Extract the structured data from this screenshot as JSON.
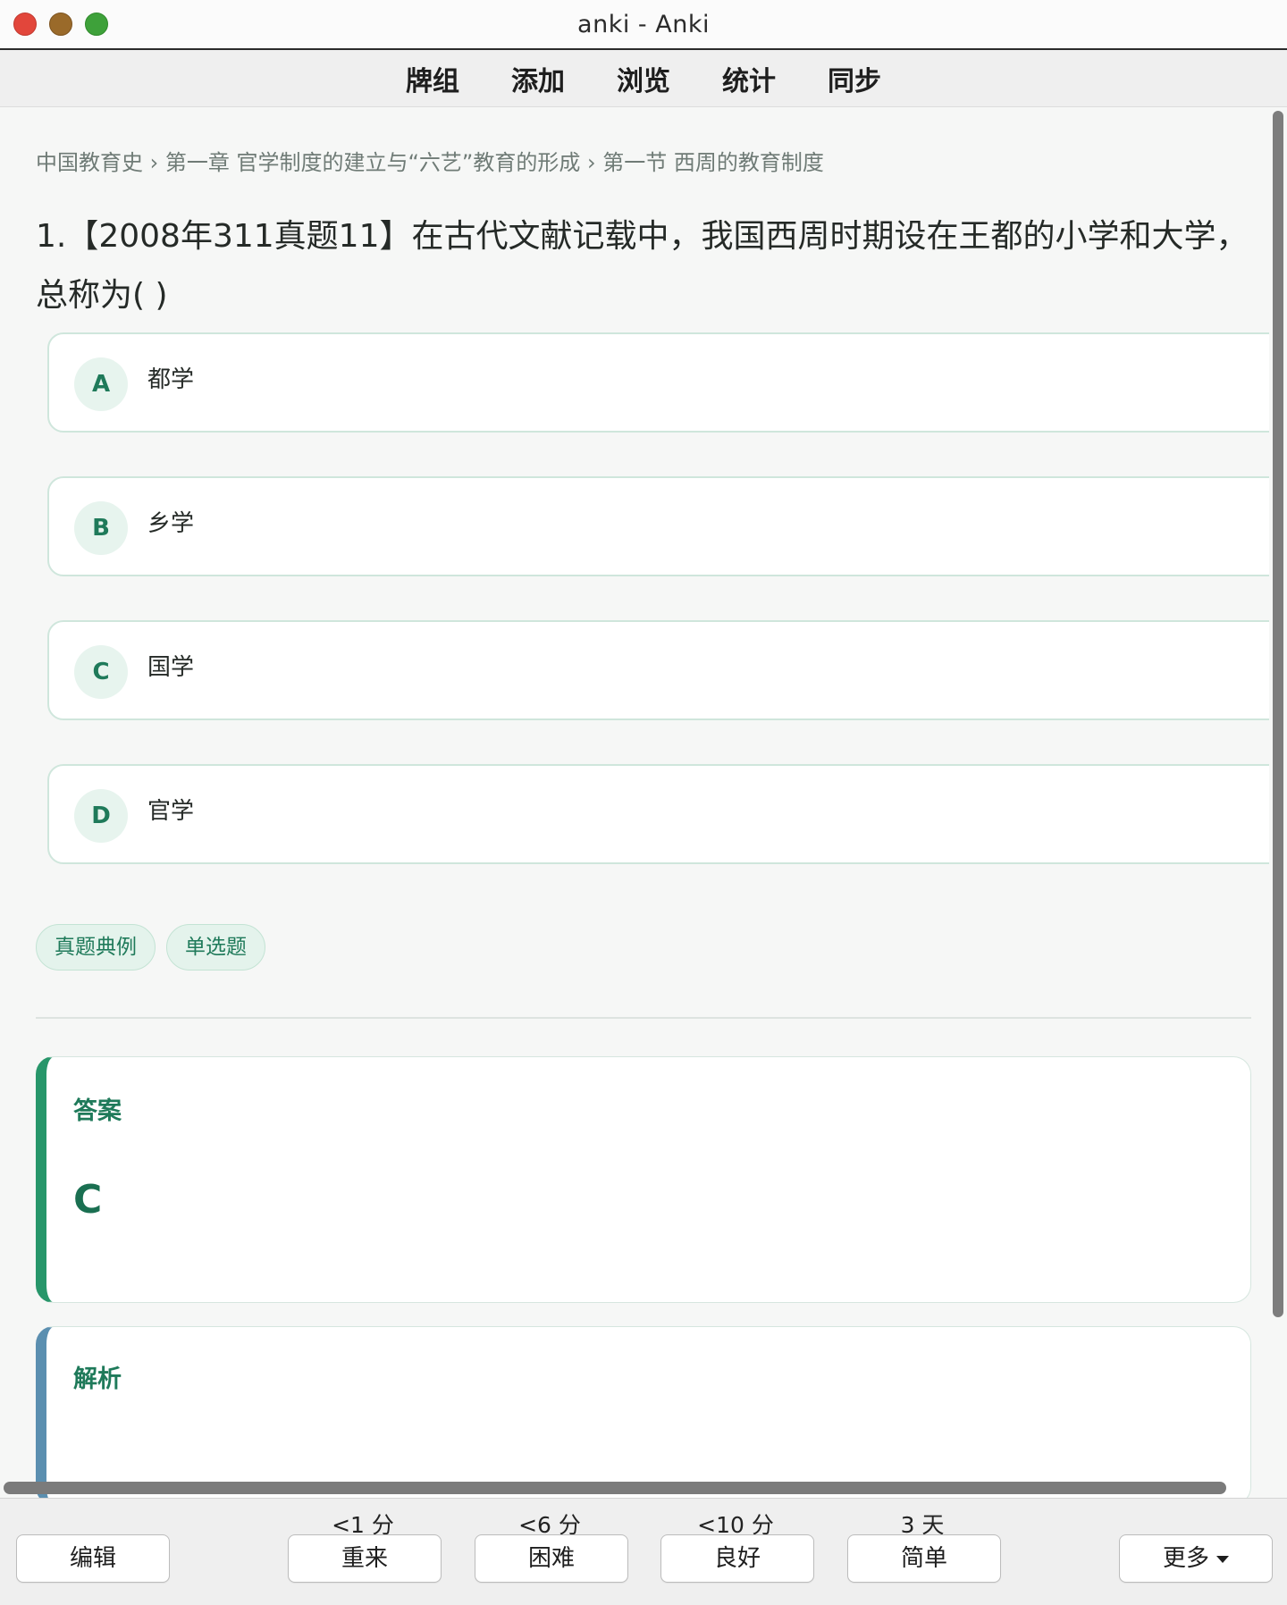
{
  "window": {
    "title": "anki - Anki",
    "colors": {
      "close": "#e2463b",
      "minimize": "#9a6a2a",
      "zoom": "#3ea13a"
    }
  },
  "menubar": {
    "items": [
      "牌组",
      "添加",
      "浏览",
      "统计",
      "同步"
    ]
  },
  "card": {
    "breadcrumb": "中国教育史 › 第一章 官学制度的建立与“六艺”教育的形成 › 第一节 西周的教育制度",
    "question": "1.【2008年311真题11】在古代文献记载中，我国西周时期设在王都的小学和大学，总称为( )",
    "options": [
      {
        "letter": "A",
        "text": "都学"
      },
      {
        "letter": "B",
        "text": "乡学"
      },
      {
        "letter": "C",
        "text": "国学"
      },
      {
        "letter": "D",
        "text": "官学"
      }
    ],
    "tags": [
      "真题典例",
      "单选题"
    ],
    "answer": {
      "title": "答案",
      "value": "C"
    },
    "analysis": {
      "title": "解析"
    },
    "accent_color": "#27966a"
  },
  "bottombar": {
    "edit_label": "编辑",
    "more_label": "更多",
    "answers": [
      {
        "label": "重来",
        "interval": "<1 分"
      },
      {
        "label": "困难",
        "interval": "<6 分"
      },
      {
        "label": "良好",
        "interval": "<10 分"
      },
      {
        "label": "简单",
        "interval": "3 天"
      }
    ]
  }
}
